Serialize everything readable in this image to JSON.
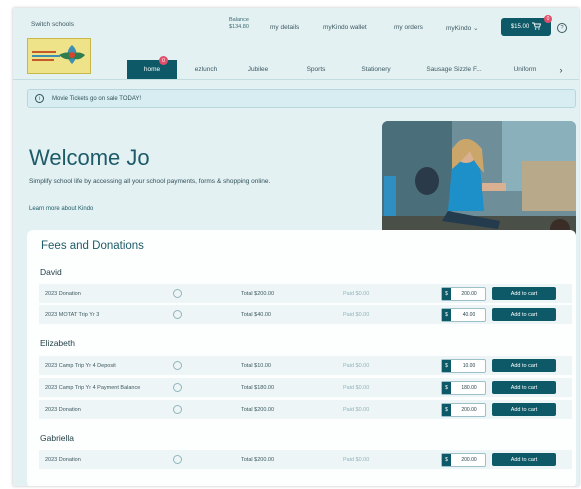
{
  "header": {
    "switch_schools": "Switch schools",
    "balance_label": "Balance",
    "balance_value": "$134.80",
    "links": [
      "my details",
      "myKindo wallet",
      "my orders",
      "myKindo ⌄"
    ],
    "cart_total": "$15.00",
    "cart_badge": "0"
  },
  "nav": {
    "tabs": [
      "home",
      "ezlunch",
      "Jubilee",
      "Sports",
      "Stationery",
      "Sausage Sizzle F...",
      "Uniform"
    ],
    "home_badge": "0"
  },
  "notice": {
    "text": "Movie Tickets go on sale TODAY!"
  },
  "hero": {
    "title": "Welcome Jo",
    "intro": "Simplify school life by accessing all your school payments, forms & shopping online.",
    "learn_more": "Learn more about Kindo"
  },
  "fees": {
    "title": "Fees and Donations",
    "currency": "$",
    "add_label": "Add to cart",
    "children": [
      {
        "name": "David",
        "items": [
          {
            "desc": "2023 Donation",
            "total": "Total  $200.00",
            "paid": "Paid  $0.00",
            "amount": "200.00"
          },
          {
            "desc": "2023 MOTAT Trip Yr 3",
            "total": "Total  $40.00",
            "paid": "Paid  $0.00",
            "amount": "40.00"
          }
        ]
      },
      {
        "name": "Elizabeth",
        "items": [
          {
            "desc": "2023 Camp Trip Yr 4 Deposit",
            "total": "Total  $10.00",
            "paid": "Paid  $0.00",
            "amount": "10.00"
          },
          {
            "desc": "2023 Camp Trip Yr 4 Payment Balance",
            "total": "Total  $180.00",
            "paid": "Paid  $0.00",
            "amount": "180.00"
          },
          {
            "desc": "2023 Donation",
            "total": "Total  $200.00",
            "paid": "Paid  $0.00",
            "amount": "200.00"
          }
        ]
      },
      {
        "name": "Gabriella",
        "items": [
          {
            "desc": "2023 Donation",
            "total": "Total  $200.00",
            "paid": "Paid  $0.00",
            "amount": "200.00"
          }
        ]
      }
    ]
  },
  "colors": {
    "accent": "#0d5967",
    "background": "#e4f1f3",
    "title": "#1d5b68",
    "badge": "#e0506a"
  },
  "icons": [
    "info-icon",
    "cart-icon",
    "help-icon",
    "chevron-right-icon",
    "school-logo"
  ]
}
